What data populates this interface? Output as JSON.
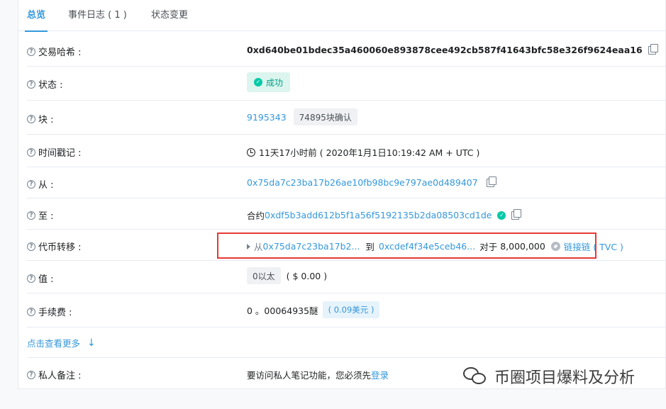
{
  "tabs": [
    {
      "label": "总览",
      "active": true
    },
    {
      "label": "事件日志 ( 1 )",
      "active": false
    },
    {
      "label": "状态变更",
      "active": false
    }
  ],
  "rows": {
    "tx_hash": {
      "label": "交易哈希 :",
      "value": "0xd640be01bdec35a460060e893878cee492cb587f41643bfc58e326f9624eaa16"
    },
    "status": {
      "label": "状态 :",
      "value": "成功"
    },
    "block": {
      "label": "块 :",
      "value": "9195343",
      "confirmations": "74895块确认"
    },
    "timestamp": {
      "label": "时间戳记 :",
      "value": "11天17小时前 ( 2020年1月1日10:19:42 AM + UTC )"
    },
    "from": {
      "label": "从 :",
      "value": "0x75da7c23ba17b26ae10fb98bc9e797ae0d489407"
    },
    "to": {
      "label": "至 :",
      "prefix": "合约",
      "value": "0xdf5b3add612b5f1a56f5192135b2da08503cd1de"
    },
    "token_transfer": {
      "label": "代币转移 :",
      "from_prefix": "从",
      "from": "0x75da7c23ba17b2...",
      "to_prefix": "到",
      "to": "0xcdef4f34e5ceb46...",
      "for_prefix": "对于",
      "amount": "8,000,000",
      "token": "链接链 ( TVC )"
    },
    "value": {
      "label": "值 :",
      "value": "0以太",
      "usd": "( $ 0.00 )"
    },
    "fee": {
      "label": "手续费 :",
      "value": "0 。00064935醚",
      "usd": "( 0.09美元 )"
    },
    "note": {
      "label": "私人备注 :",
      "text": "要访问私人笔记功能，您必须先",
      "link": "登录"
    }
  },
  "more": {
    "label": "点击查看更多",
    "icon": "arrow-down-icon"
  },
  "watermark": {
    "text": "币圈项目爆料及分析"
  },
  "colors": {
    "link": "#3498db",
    "success": "#00c9a7",
    "highlight": "#e53935"
  }
}
